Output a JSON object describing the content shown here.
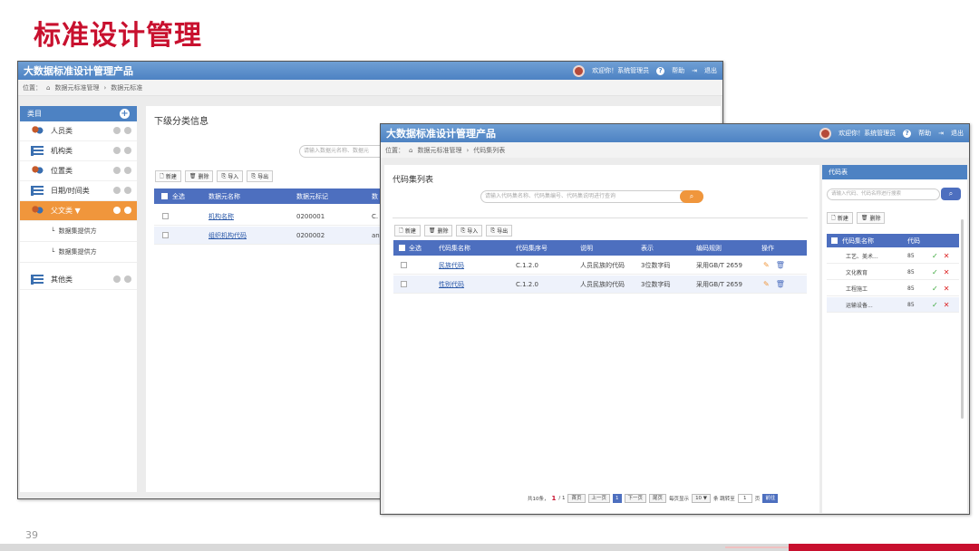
{
  "slide": {
    "title": "标准设计管理",
    "page": "39"
  },
  "win1": {
    "title": "大数据标准设计管理产品",
    "user": {
      "welcome": "欢迎你！系统管理员",
      "help": "帮助",
      "logout": "退出"
    },
    "breadcrumb": [
      "位置：",
      "数据元标准管理",
      "数据元标准"
    ],
    "sidebar": {
      "header": "类目",
      "items": [
        {
          "label": "人员类",
          "icon": "people-icon"
        },
        {
          "label": "机构类",
          "icon": "list-icon"
        },
        {
          "label": "位置类",
          "icon": "people-icon"
        },
        {
          "label": "日期/时间类",
          "icon": "list-icon"
        },
        {
          "label": "父文类 ▼",
          "icon": "people-icon",
          "active": true
        }
      ],
      "subitems": [
        "数据集提供方",
        "数据集提供方"
      ],
      "last_item": {
        "label": "其他类",
        "icon": "list-icon"
      }
    },
    "main": {
      "title": "下级分类信息",
      "search_placeholder": "请输入数据元名称、数据元",
      "toolbar": [
        "新建",
        "删除",
        "导入",
        "导出"
      ],
      "columns": [
        "全选",
        "数据元名称",
        "数据元标记",
        "数"
      ],
      "rows": [
        {
          "name": "机构名称",
          "code": "0200001",
          "extra": "C."
        },
        {
          "name": "组织机构代码",
          "code": "0200002",
          "extra": "an"
        }
      ]
    }
  },
  "win2": {
    "title": "大数据标准设计管理产品",
    "user": {
      "welcome": "欢迎你！系统管理员",
      "help": "帮助",
      "logout": "退出"
    },
    "breadcrumb": [
      "位置：",
      "数据元标准管理",
      "代码集列表"
    ],
    "main": {
      "title": "代码集列表",
      "search_placeholder": "请输入代码集名称、代码集编号、代码集说明进行查询",
      "toolbar": [
        "新建",
        "删除",
        "导入",
        "导出"
      ],
      "columns": [
        "全选",
        "代码集名称",
        "代码集序号",
        "说明",
        "表示",
        "编码规则",
        "操作"
      ],
      "rows": [
        {
          "name": "民族代码",
          "seq": "C.1.2.0",
          "desc": "人员民族的代码",
          "repr": "3位数字码",
          "rule": "采用GB/T 2659"
        },
        {
          "name": "性别代码",
          "seq": "C.1.2.0",
          "desc": "人员民族的代码",
          "repr": "3位数字码",
          "rule": "采用GB/T 2659"
        }
      ],
      "pager": {
        "total": "共10条，",
        "page": "1",
        "of": "/ 1",
        "first": "首页",
        "prev": "上一页",
        "current": "1",
        "next": "下一页",
        "last": "尾页",
        "per_page_label": "每页显示",
        "per_page": "10 ▼",
        "jump_label": "条 跳转至",
        "jump_val": "1",
        "page_unit": "页",
        "go": "前往"
      }
    },
    "side": {
      "header": "代码表",
      "search_placeholder": "请输入代码、代码名称进行搜索",
      "toolbar": [
        "新建",
        "删除"
      ],
      "columns": [
        "代码集名称",
        "代码"
      ],
      "rows": [
        {
          "name": "工艺、美术...",
          "code": "85"
        },
        {
          "name": "文化教育",
          "code": "85"
        },
        {
          "name": "工程施工",
          "code": "85"
        },
        {
          "name": "运输设备...",
          "code": "85"
        }
      ]
    }
  },
  "colors": {
    "brand_red": "#c8102e",
    "header_blue": "#4d82c3",
    "table_blue": "#4d6fbf",
    "accent_orange": "#f0963c"
  }
}
